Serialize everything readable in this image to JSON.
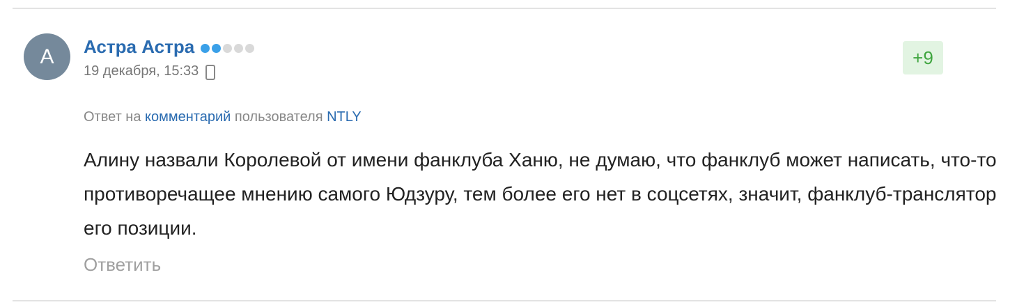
{
  "comment": {
    "avatar_letter": "А",
    "author": "Астра Астра",
    "rating_dots": {
      "filled": 2,
      "total": 5,
      "filled_color": "#3aa0e8",
      "empty_color": "#d9d9d9"
    },
    "date": "19 декабря, 15:33",
    "device_icon": "mobile-phone-icon",
    "score": "+9",
    "reply_to": {
      "prefix": "Ответ на",
      "comment_link": "комментарий",
      "middle": "пользователя",
      "user_link": "NTLY"
    },
    "text": "Алину назвали Королевой от имени фанклуба Ханю, не думаю, что фанклуб может написать, что-то противоречащее мнению самого Юдзуру, тем более его нет в соцсетях, значит, фанклуб-транслятор его позиции.",
    "reply_label": "Ответить"
  },
  "colors": {
    "link": "#2a6bb0",
    "score_text": "#3ea53e",
    "score_bg": "#e2f4e2",
    "avatar_bg": "#75899b"
  }
}
